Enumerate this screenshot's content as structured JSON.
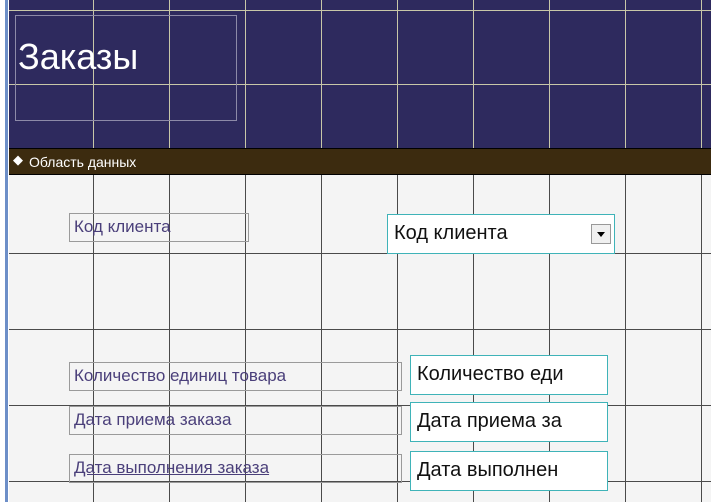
{
  "header": {
    "title": "Заказы"
  },
  "section": {
    "label": "Область данных",
    "icon": "section-collapse-icon"
  },
  "fields": [
    {
      "label": "Код клиента",
      "control": "Код клиента",
      "type": "combo"
    },
    {
      "label": "Количество единиц товара",
      "control": "Количество еди"
    },
    {
      "label": "Дата приема заказа",
      "control": "Дата приема за"
    },
    {
      "label": "Дата выполнения заказа",
      "control": "Дата выполнен"
    }
  ],
  "colors": {
    "header_bg": "#2e2a5e",
    "section_bg": "#3c2b0f",
    "grid_bg": "#f4f4f4",
    "field_border": "#3fb3b8",
    "label_text": "#4a3f7a"
  }
}
